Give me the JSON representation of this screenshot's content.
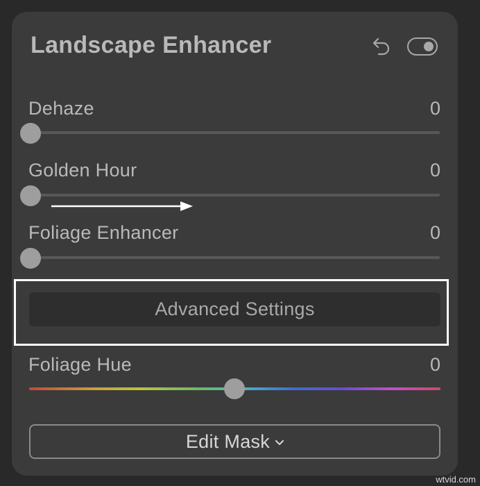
{
  "panel": {
    "title": "Landscape Enhancer",
    "toggle_on": true,
    "sliders": [
      {
        "label": "Dehaze",
        "value": "0"
      },
      {
        "label": "Golden Hour",
        "value": "0"
      },
      {
        "label": "Foliage Enhancer",
        "value": "0"
      }
    ],
    "advanced_settings_label": "Advanced Settings",
    "foliage_hue": {
      "label": "Foliage Hue",
      "value": "0"
    },
    "edit_mask_label": "Edit Mask"
  },
  "icons": {
    "undo": "undo-icon",
    "toggle": "toggle-switch",
    "chevron": "chevron-down-icon",
    "arrow": "arrow-right-icon"
  },
  "colors": {
    "panel_bg": "#3b3b3b",
    "page_bg": "#292929",
    "highlight_outline": "#ffffff",
    "hue_gradient": [
      "#c5473a",
      "#c9a23a",
      "#b9c43b",
      "#6ab86b",
      "#4cb6c4",
      "#3d6ed3",
      "#6b4bd3",
      "#c44fc9",
      "#d24768"
    ]
  },
  "watermark": "wtvid.com"
}
